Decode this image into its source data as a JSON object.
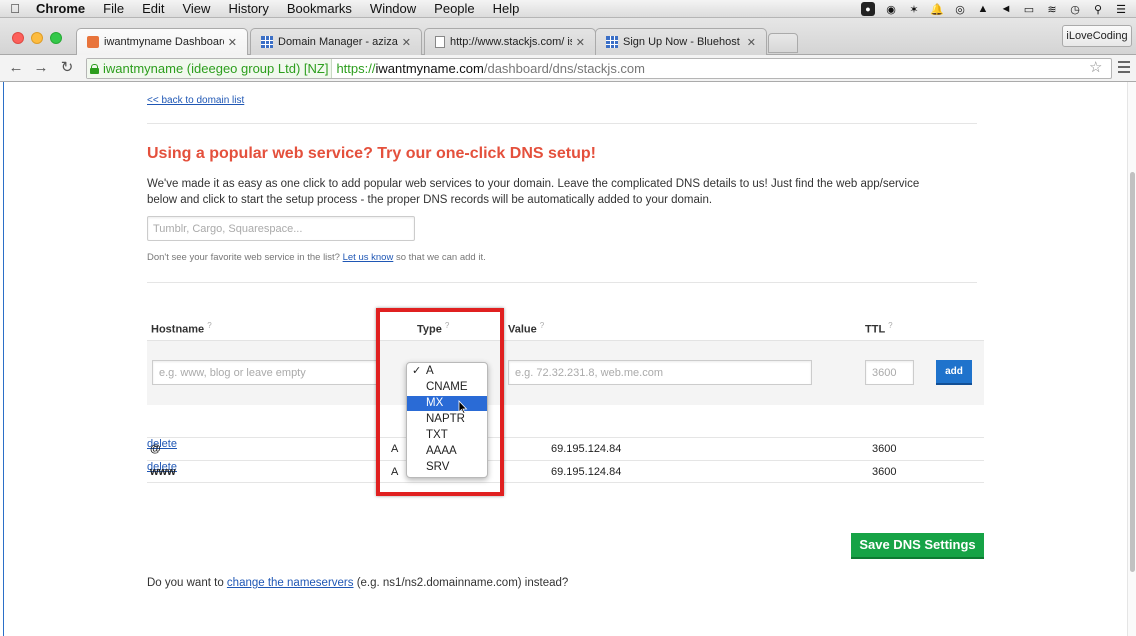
{
  "menubar": {
    "app": "Chrome",
    "items": [
      "File",
      "Edit",
      "View",
      "History",
      "Bookmarks",
      "Window",
      "People",
      "Help"
    ]
  },
  "tabs": [
    {
      "title": "iwantmyname Dashboard |",
      "favicon": "iwantmyname-favicon",
      "active": true
    },
    {
      "title": "Domain Manager - azizali",
      "favicon": "bluehost-grid-favicon",
      "active": false
    },
    {
      "title": "http://www.stackjs.com/ is",
      "favicon": "page-favicon",
      "active": false
    },
    {
      "title": "Sign Up Now - Bluehost",
      "favicon": "bluehost-grid-favicon",
      "active": false
    }
  ],
  "profile_button": "iLoveCoding",
  "address_bar": {
    "ev_label": "iwantmyname (ideegeo group Ltd) [NZ]",
    "protocol": "https://",
    "host": "iwantmyname.com",
    "path": "/dashboard/dns/stackjs.com"
  },
  "page": {
    "back_link": "<< back to domain list",
    "promo_title": "Using a popular web service? Try our one-click DNS setup!",
    "promo_text": "We've made it as easy as one click to add popular web services to your domain. Leave the complicated DNS details to us! Just find the web app/service below and click to start the setup process - the proper DNS records will be automatically added to your domain.",
    "service_search_placeholder": "Tumblr, Cargo, Squarespace...",
    "missing_note_before": "Don't see your favorite web service in the list?",
    "missing_note_link": "Let us know",
    "missing_note_after": "so that we can add it.",
    "table": {
      "headers": {
        "hostname": "Hostname",
        "type": "Type",
        "value": "Value",
        "ttl": "TTL",
        "help": "?"
      },
      "hostname_placeholder": "e.g. www, blog or leave empty",
      "value_placeholder": "e.g. 72.32.231.8, web.me.com",
      "ttl_placeholder": "3600",
      "add_label": "add",
      "rows": [
        {
          "host": "@",
          "type": "A",
          "value": "69.195.124.84",
          "ttl": "3600",
          "action": "delete"
        },
        {
          "host": "www",
          "type": "A",
          "value": "69.195.124.84",
          "ttl": "3600",
          "action": "delete"
        }
      ]
    },
    "type_dropdown": {
      "options": [
        "A",
        "CNAME",
        "MX",
        "NAPTR",
        "TXT",
        "AAAA",
        "SRV"
      ],
      "checked": "A",
      "hovered": "MX"
    },
    "save_label": "Save DNS Settings",
    "ns_note_before": "Do you want to",
    "ns_note_link": "change the nameservers",
    "ns_note_after": "(e.g. ns1/ns2.domainname.com) instead?"
  },
  "colors": {
    "promo_title": "#e4503c",
    "save_button": "#16a346",
    "add_button": "#1f73cc",
    "highlight": "#e02020",
    "selection": "#2a6bd6",
    "ev_green": "#2c9e1d"
  }
}
